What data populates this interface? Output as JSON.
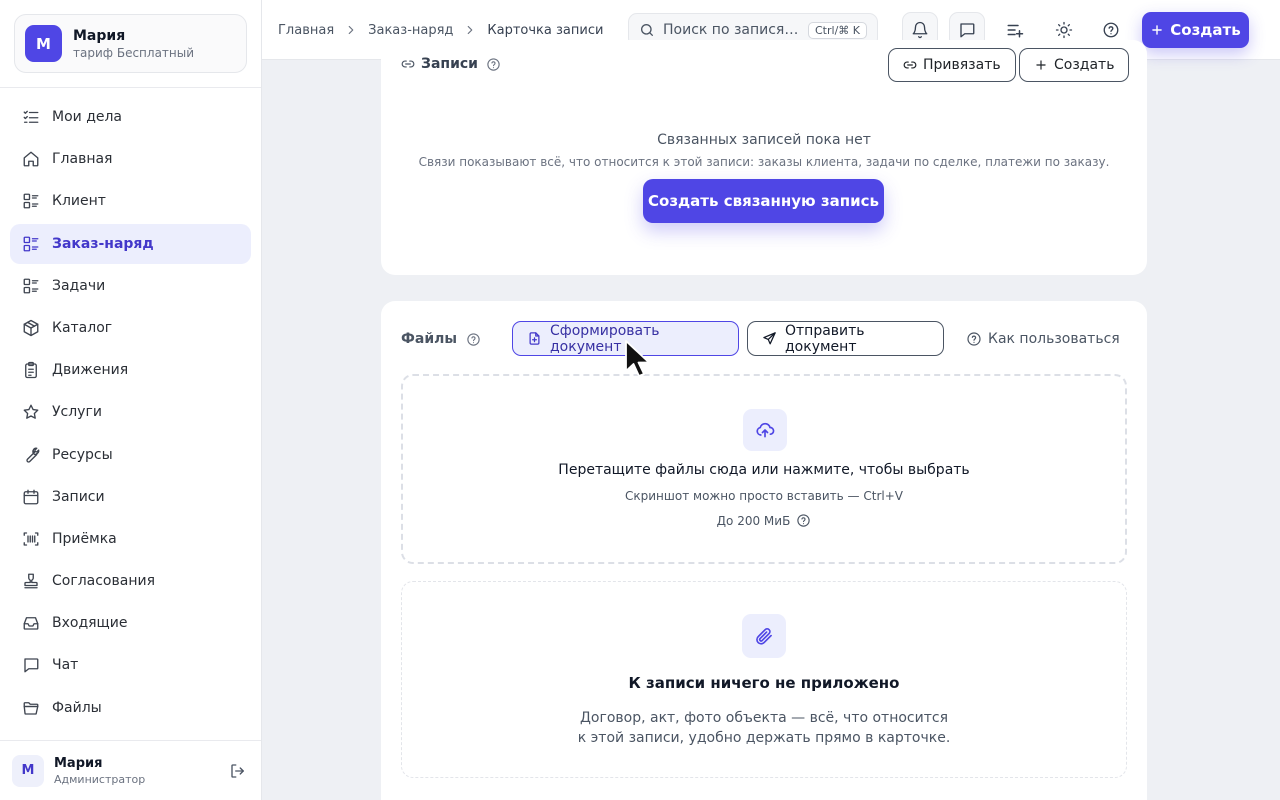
{
  "account": {
    "initial": "М",
    "name": "Мария",
    "plan": "тариф Бесплатный"
  },
  "sidebar": {
    "items": [
      {
        "label": "Мои дела",
        "icon": "task-list-icon"
      },
      {
        "label": "Главная",
        "icon": "home-icon"
      },
      {
        "label": "Клиент",
        "icon": "list-icon"
      },
      {
        "label": "Заказ-наряд",
        "icon": "list-icon",
        "active": true
      },
      {
        "label": "Задачи",
        "icon": "list-icon"
      },
      {
        "label": "Каталог",
        "icon": "box-icon"
      },
      {
        "label": "Движения",
        "icon": "clipboard-icon"
      },
      {
        "label": "Услуги",
        "icon": "star-icon"
      },
      {
        "label": "Ресурсы",
        "icon": "wrench-icon"
      },
      {
        "label": "Записи",
        "icon": "calendar-icon"
      },
      {
        "label": "Приёмка",
        "icon": "scan-barcode-icon"
      },
      {
        "label": "Согласования",
        "icon": "stamp-icon"
      },
      {
        "label": "Входящие",
        "icon": "inbox-icon"
      },
      {
        "label": "Чат",
        "icon": "chat-icon"
      },
      {
        "label": "Файлы",
        "icon": "folder-icon"
      }
    ]
  },
  "user": {
    "initial": "М",
    "name": "Мария",
    "role": "Администратор"
  },
  "breadcrumb": [
    "Главная",
    "Заказ-наряд",
    "Карточка записи"
  ],
  "search": {
    "placeholder": "Поиск по записям...",
    "shortcut": "Ctrl/⌘ K"
  },
  "topbar": {
    "create_label": "Создать"
  },
  "records": {
    "title": "Записи",
    "link_label": "Привязать",
    "create_label": "Создать",
    "empty_title": "Связанных записей пока нет",
    "empty_sub": "Связи показывают всё, что относится к этой записи: заказы клиента, задачи по сделке, платежи по заказу.",
    "create_related_label": "Создать связанную запись"
  },
  "files": {
    "title": "Файлы",
    "generate_label": "Сформировать документ",
    "send_label": "Отправить документ",
    "howto_label": "Как пользоваться",
    "drop_title": "Перетащите файлы сюда или нажмите, чтобы выбрать",
    "drop_sub": "Скриншот можно просто вставить — Ctrl+V",
    "drop_limit": "До 200 МиБ",
    "empty_title": "К записи ничего не приложено",
    "empty_sub": "Договор, акт, фото объекта — всё, что относится к этой записи, удобно держать прямо в карточке."
  },
  "colors": {
    "accent": "#4f46e5",
    "accent_soft": "#eceefd",
    "background": "#eef0f4"
  }
}
